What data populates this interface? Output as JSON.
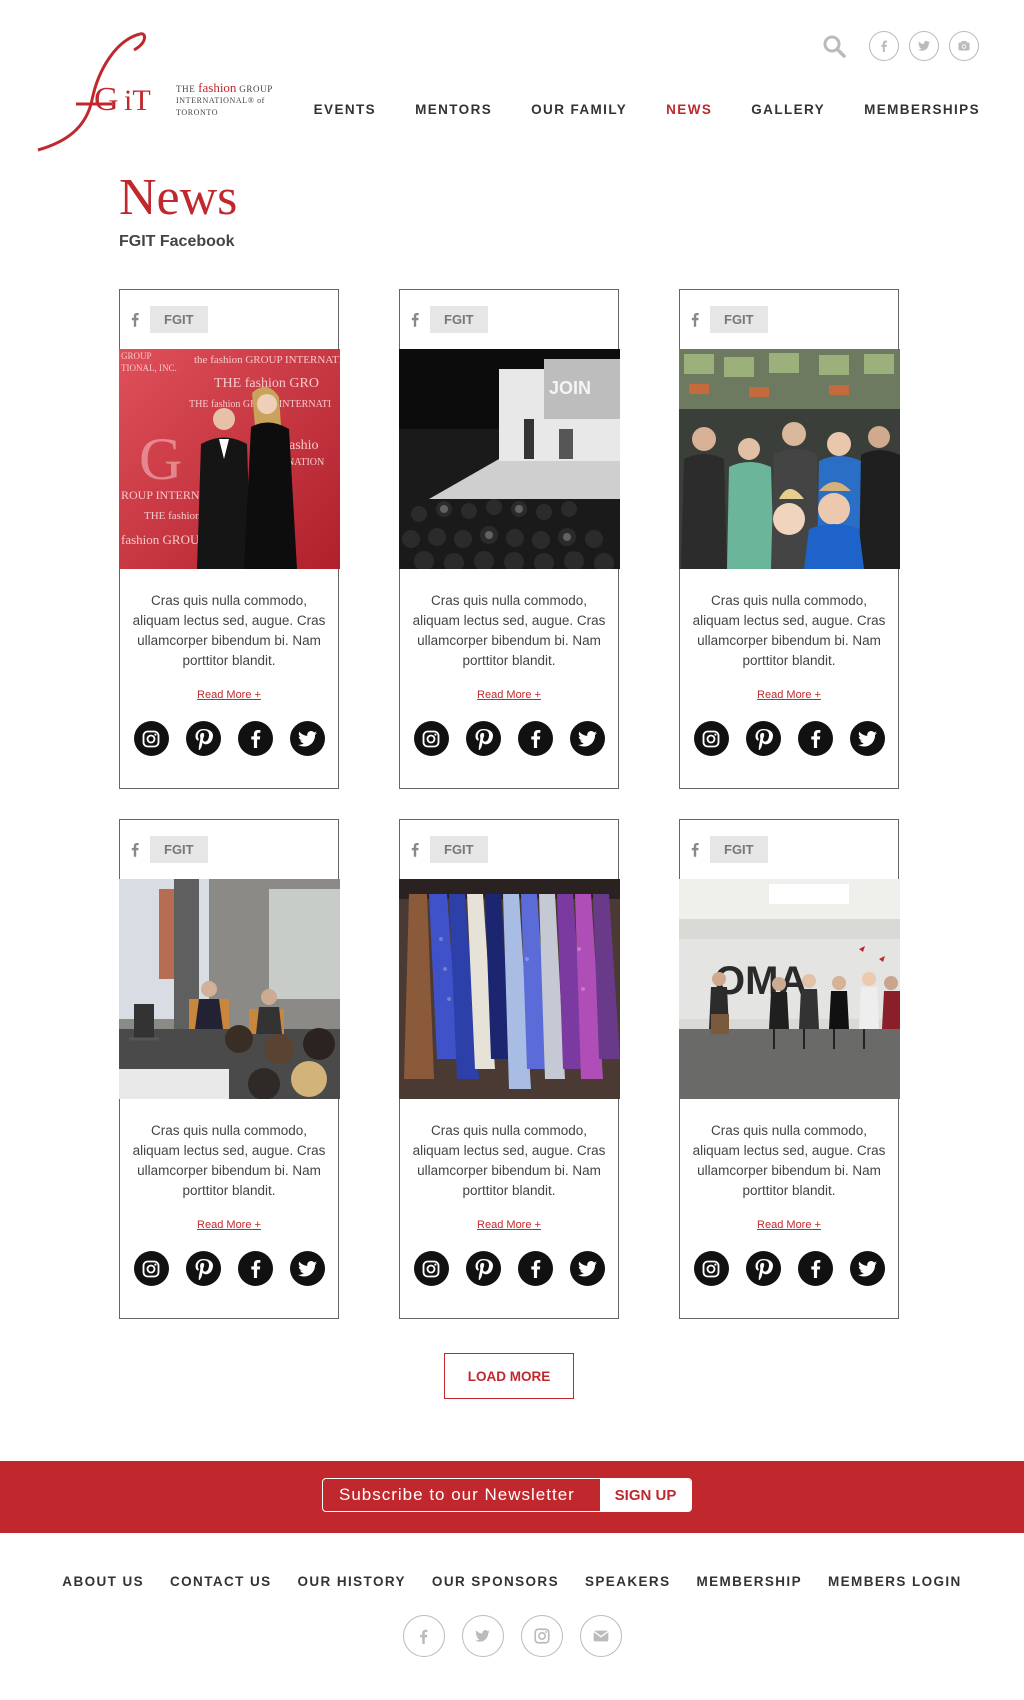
{
  "brand": {
    "logo_mark": "fGiT",
    "line1_prefix": "THE",
    "line1_fashion": "fashion",
    "line1_suffix": "GROUP",
    "line2": "INTERNATIONAL® of",
    "line3": "TORONTO",
    "accent": "#c0282d"
  },
  "header_icons": [
    "search-icon",
    "facebook-icon",
    "twitter-icon",
    "instagram-icon"
  ],
  "nav": [
    {
      "label": "EVENTS"
    },
    {
      "label": "MENTORS"
    },
    {
      "label": "OUR FAMILY"
    },
    {
      "label": "NEWS",
      "active": true
    },
    {
      "label": "GALLERY"
    },
    {
      "label": "MEMBERSHIPS"
    }
  ],
  "page": {
    "title": "News",
    "subtitle": "FGIT Facebook"
  },
  "cards": [
    {
      "source": "FGIT",
      "text": "Cras quis nulla commodo, aliquam lectus sed, augue. Cras ullamcorper bibendum bi. Nam porttitor blandit.",
      "read_more": "Read More +",
      "photo": "gala-red-carpet"
    },
    {
      "source": "FGIT",
      "text": "Cras quis nulla commodo, aliquam lectus sed, augue. Cras ullamcorper bibendum bi. Nam porttitor blandit.",
      "read_more": "Read More +",
      "photo": "auditorium-bw"
    },
    {
      "source": "FGIT",
      "text": "Cras quis nulla commodo, aliquam lectus sed, augue. Cras ullamcorper bibendum bi. Nam porttitor blandit.",
      "read_more": "Read More +",
      "photo": "crowd-event"
    },
    {
      "source": "FGIT",
      "text": "Cras quis nulla commodo, aliquam lectus sed, augue. Cras ullamcorper bibendum bi. Nam porttitor blandit.",
      "read_more": "Read More +",
      "photo": "lounge-talk"
    },
    {
      "source": "FGIT",
      "text": "Cras quis nulla commodo, aliquam lectus sed, augue. Cras ullamcorper bibendum bi. Nam porttitor blandit.",
      "read_more": "Read More +",
      "photo": "ties-rack"
    },
    {
      "source": "FGIT",
      "text": "Cras quis nulla commodo, aliquam lectus sed, augue. Cras ullamcorper bibendum bi. Nam porttitor blandit.",
      "read_more": "Read More +",
      "photo": "panel-talk"
    }
  ],
  "card_social_icons": [
    "instagram-icon",
    "pinterest-icon",
    "facebook-icon",
    "twitter-icon"
  ],
  "load_more": "LOAD MORE",
  "newsletter": {
    "placeholder": "Subscribe to our Newsletter",
    "button": "SIGN UP"
  },
  "footer_nav": [
    {
      "label": "ABOUT US"
    },
    {
      "label": "CONTACT US"
    },
    {
      "label": "OUR HISTORY"
    },
    {
      "label": "OUR SPONSORS"
    },
    {
      "label": "SPEAKERS"
    },
    {
      "label": "MEMBERSHIP"
    },
    {
      "label": "MEMBERS LOGIN"
    }
  ],
  "footer_icons": [
    "facebook-icon",
    "twitter-icon",
    "instagram-icon",
    "email-icon"
  ]
}
